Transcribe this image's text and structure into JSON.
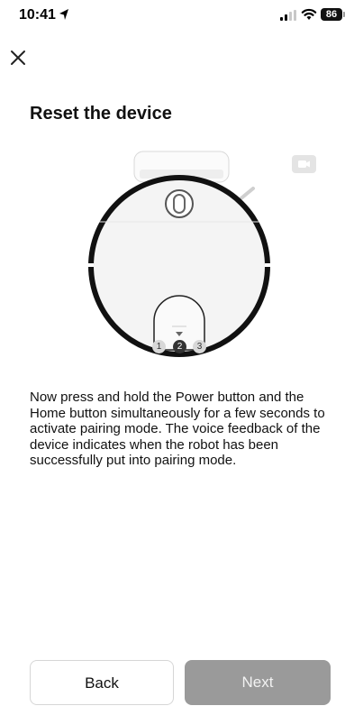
{
  "status_bar": {
    "time": "10:41",
    "battery": "86"
  },
  "page": {
    "title": "Reset the device",
    "steps": [
      "1",
      "2",
      "3"
    ],
    "instructions": "Now press and hold the Power button and the Home button simultaneously for a few seconds to activate pairing mode. The voice feedback of the device indicates when the robot has been successfully put into pairing mode."
  },
  "footer": {
    "back_label": "Back",
    "next_label": "Next"
  },
  "colors": {
    "next_button_bg": "#9a9a9a",
    "robot_bumper": "#111111",
    "robot_body": "#f4f4f4"
  }
}
